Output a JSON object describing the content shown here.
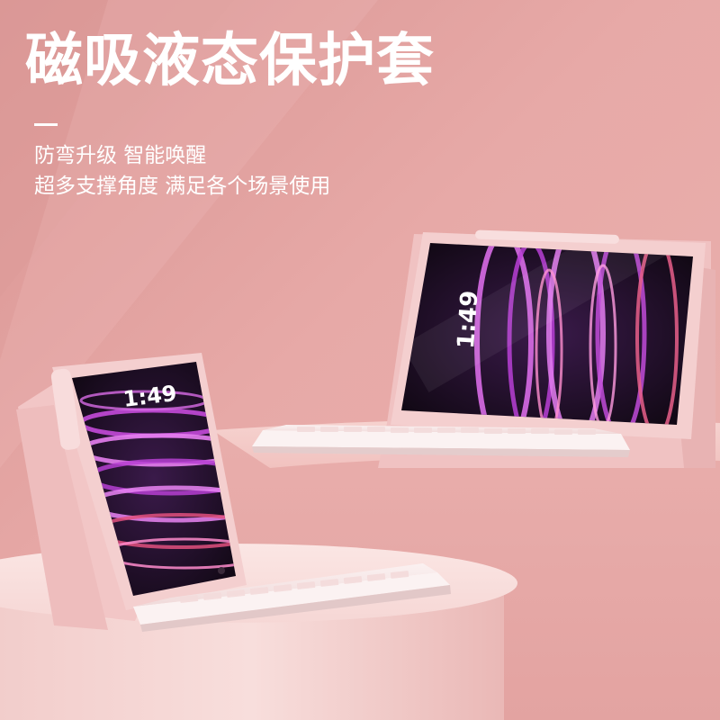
{
  "headline": "磁吸液态保护套",
  "features": {
    "line1": "防弯升级 智能唤醒",
    "line2": "超多支撑角度 满足各个场景使用"
  },
  "tablet_left": {
    "clock": "1:49"
  },
  "tablet_right": {
    "clock": "1:49"
  },
  "colors": {
    "background": "#e9a9a7",
    "case_pink": "#f2c8c8",
    "keyboard": "#f8eaea",
    "text": "#ffffff"
  }
}
